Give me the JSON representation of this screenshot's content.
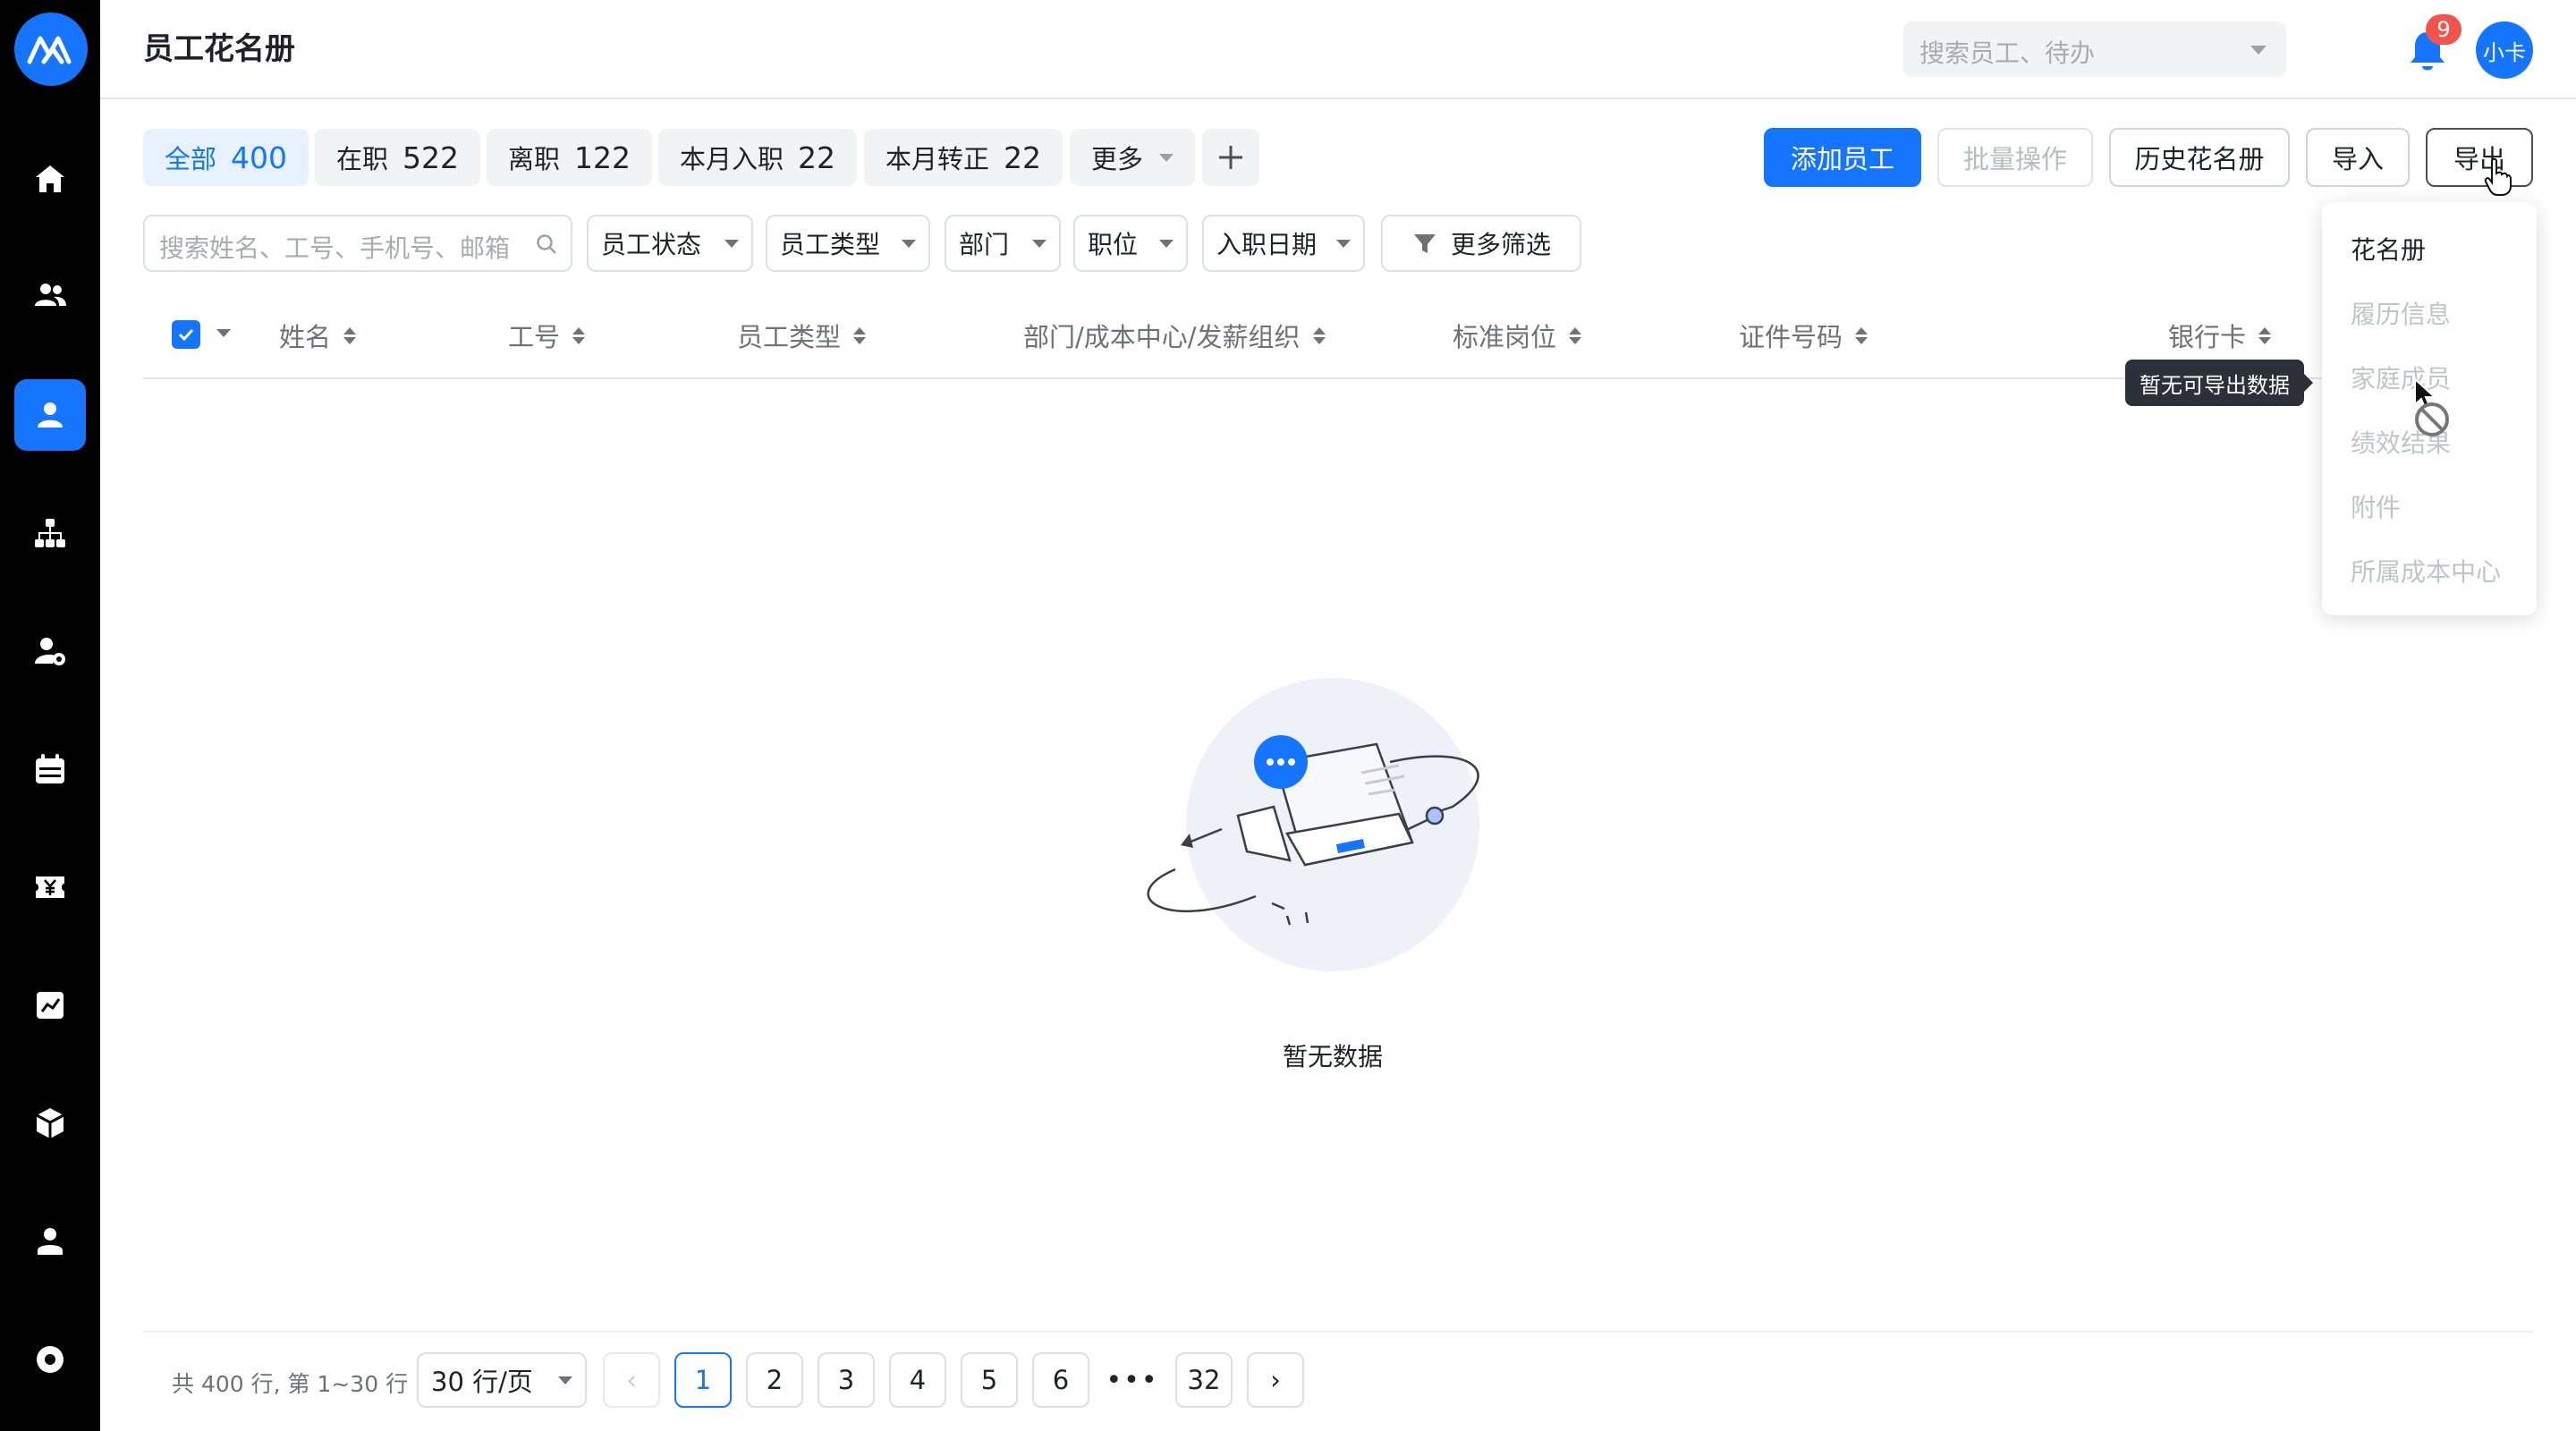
{
  "page_title": "员工花名册",
  "header": {
    "search_placeholder": "搜索员工、待办",
    "notification_count": "9",
    "user_avatar_text": "小卡"
  },
  "tabs": [
    {
      "label": "全部",
      "count": "400",
      "active": true
    },
    {
      "label": "在职",
      "count": "522"
    },
    {
      "label": "离职",
      "count": "122"
    },
    {
      "label": "本月入职",
      "count": "22"
    },
    {
      "label": "本月转正",
      "count": "22"
    },
    {
      "label": "更多"
    }
  ],
  "actions": {
    "add_employee": "添加员工",
    "batch_operations": "批量操作",
    "history_roster": "历史花名册",
    "import": "导入",
    "export": "导出"
  },
  "filters": {
    "search_placeholder": "搜索姓名、工号、手机号、邮箱",
    "employee_status": "员工状态",
    "employee_type": "员工类型",
    "department": "部门",
    "position": "职位",
    "hire_date": "入职日期",
    "more_filters": "更多筛选"
  },
  "table": {
    "columns": [
      "姓名",
      "工号",
      "员工类型",
      "部门/成本中心/发薪组织",
      "标准岗位",
      "证件号码",
      "银行卡"
    ],
    "rows": []
  },
  "empty_state": {
    "text": "暂无数据"
  },
  "pagination": {
    "summary": "共 400 行, 第 1~30 行",
    "page_size": "30 行/页",
    "pages": [
      "1",
      "2",
      "3",
      "4",
      "5",
      "6"
    ],
    "ellipsis": "•••",
    "last_page": "32",
    "current_page": "1",
    "prev": "‹",
    "next": "›"
  },
  "export_menu": {
    "items": [
      {
        "label": "花名册",
        "enabled": true
      },
      {
        "label": "履历信息",
        "enabled": false
      },
      {
        "label": "家庭成员",
        "enabled": false
      },
      {
        "label": "绩效结果",
        "enabled": false
      },
      {
        "label": "附件",
        "enabled": false
      },
      {
        "label": "所属成本中心",
        "enabled": false
      }
    ],
    "tooltip": "暂无可导出数据"
  },
  "colors": {
    "primary": "#1675ff",
    "sidebar_bg": "#000000",
    "badge": "#f5544c",
    "tab_active_bg": "#e8f1ff"
  }
}
